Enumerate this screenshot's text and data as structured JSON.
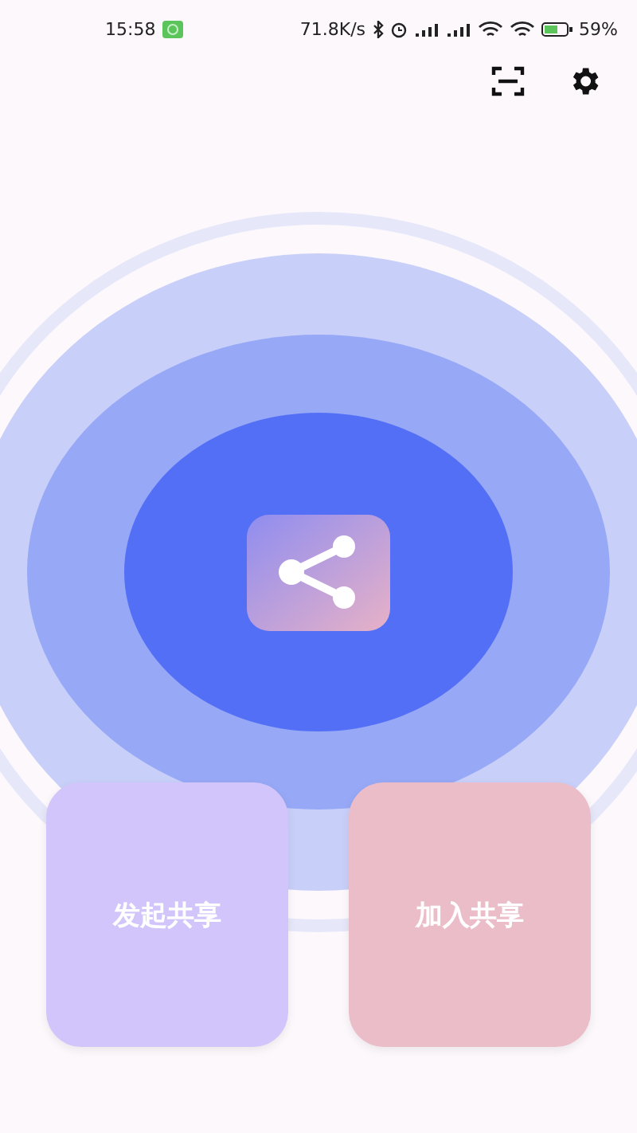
{
  "status_bar": {
    "time": "15:58",
    "net_speed": "71.8K/s",
    "battery": "59%"
  },
  "actions": [
    {
      "label": "发起共享",
      "color": "#d2c5fb"
    },
    {
      "label": "加入共享",
      "color": "#ebbdc8"
    }
  ]
}
